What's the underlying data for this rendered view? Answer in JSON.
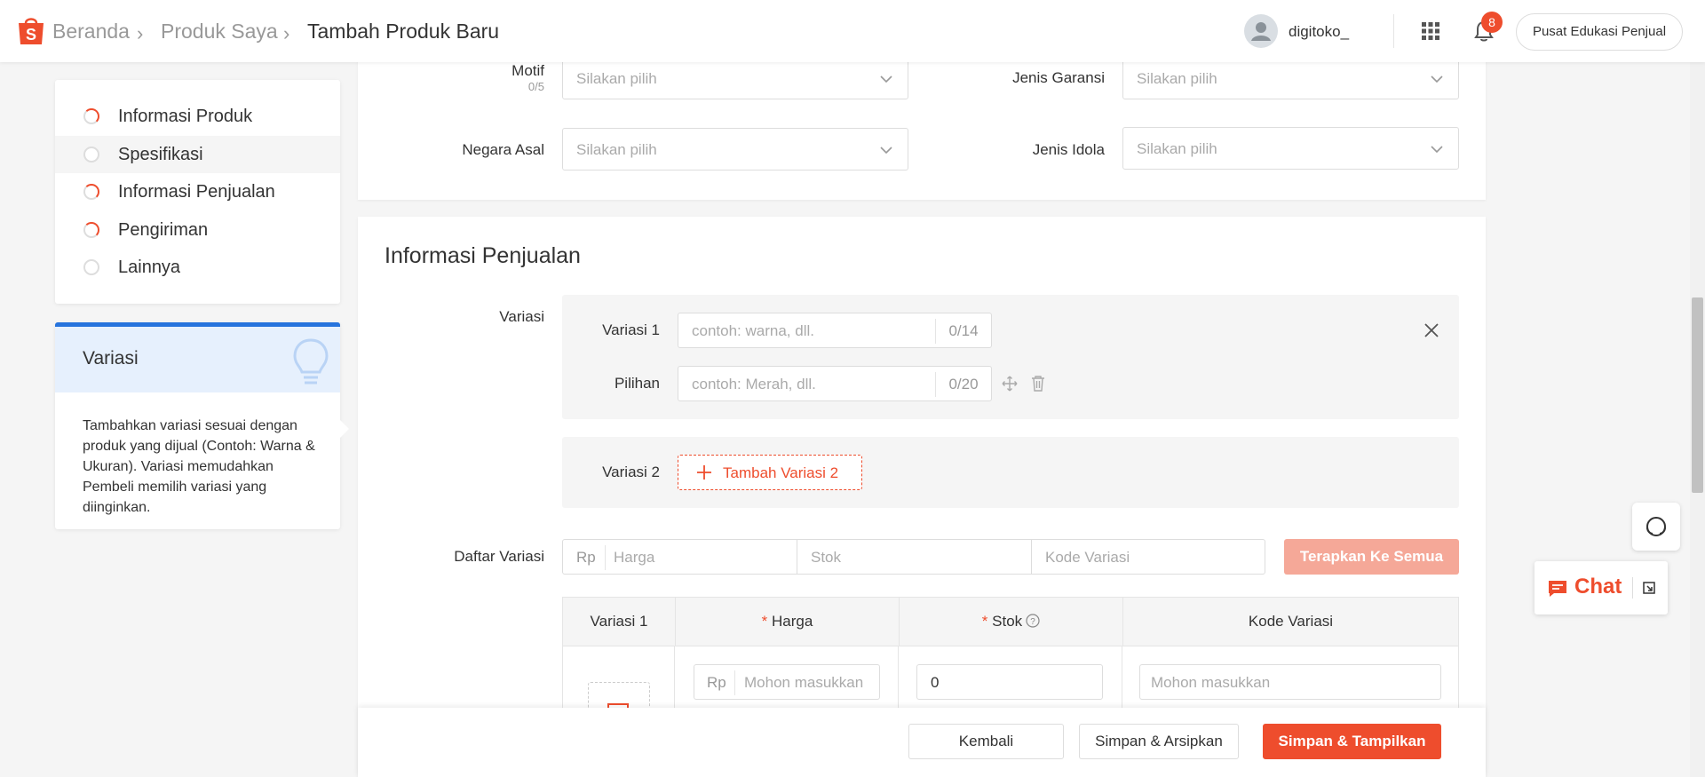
{
  "header": {
    "breadcrumb": [
      "Beranda",
      "Produk Saya",
      "Tambah Produk Baru"
    ],
    "username": "digitoko_",
    "notification_count": "8",
    "edu_button": "Pusat Edukasi Penjual",
    "brand_color": "#ee4d2d"
  },
  "nav": {
    "items": [
      {
        "label": "Informasi Produk",
        "state": "partial"
      },
      {
        "label": "Spesifikasi",
        "state": "active"
      },
      {
        "label": "Informasi Penjualan",
        "state": "partial"
      },
      {
        "label": "Pengiriman",
        "state": "partial"
      },
      {
        "label": "Lainnya",
        "state": "empty"
      }
    ]
  },
  "tip": {
    "title": "Variasi",
    "body": "Tambahkan variasi sesuai dengan produk yang dijual (Contoh: Warna & Ukuran). Variasi memudahkan Pembeli memilih variasi yang diinginkan."
  },
  "spec": {
    "motif_label": "Motif",
    "motif_count": "0/5",
    "motif_placeholder": "Silakan pilih",
    "garansi_label": "Jenis Garansi",
    "garansi_placeholder": "Silakan pilih",
    "negara_label": "Negara Asal",
    "negara_placeholder": "Silakan pilih",
    "idola_label": "Jenis Idola",
    "idola_placeholder": "Silakan pilih"
  },
  "sales": {
    "title": "Informasi Penjualan",
    "variasi_label": "Variasi",
    "var1_label": "Variasi 1",
    "var1_placeholder": "contoh: warna, dll.",
    "var1_count": "0/14",
    "pilihan_label": "Pilihan",
    "pilihan_placeholder": "contoh: Merah, dll.",
    "pilihan_count": "0/20",
    "var2_label": "Variasi 2",
    "add_var2": "Tambah Variasi 2",
    "daftar_label": "Daftar Variasi",
    "bulk_currency": "Rp",
    "bulk_price_placeholder": "Harga",
    "bulk_stock_placeholder": "Stok",
    "bulk_code_placeholder": "Kode Variasi",
    "apply_all": "Terapkan Ke Semua"
  },
  "table": {
    "columns": [
      "Variasi 1",
      "Harga",
      "Stok",
      "Kode Variasi"
    ],
    "required_mark": "*",
    "row": {
      "currency": "Rp",
      "price_placeholder": "Mohon masukkan",
      "stock_value": "0",
      "code_placeholder": "Mohon masukkan"
    }
  },
  "footer": {
    "back": "Kembali",
    "save_archive": "Simpan & Arsipkan",
    "save_show": "Simpan & Tampilkan"
  },
  "chat": {
    "label": "Chat"
  }
}
